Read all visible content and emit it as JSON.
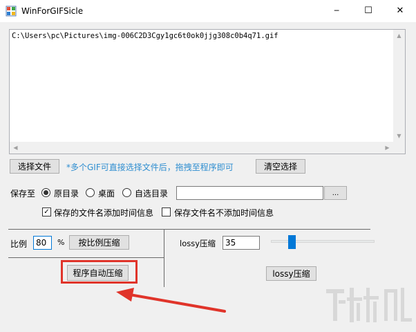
{
  "window": {
    "title": "WinForGIFSicle",
    "minimize_glyph": "─",
    "maximize_glyph": "☐",
    "close_glyph": "✕"
  },
  "file_list": {
    "items": [
      "C:\\Users\\pc\\Pictures\\img-006C2D3Cgy1gc6t0ok0jjg308c0b4q71.gif"
    ],
    "scroll_up": "▲",
    "scroll_down": "▼",
    "scroll_left": "◀",
    "scroll_right": "▶"
  },
  "file_actions": {
    "select_label": "选择文件",
    "hint": "*多个GIF可直接选择文件后，拖拽至程序即可",
    "clear_label": "清空选择"
  },
  "save": {
    "label": "保存至",
    "options": [
      "原目录",
      "桌面",
      "自选目录"
    ],
    "selected": "原目录",
    "path_value": "",
    "browse_label": "...",
    "add_time_label": "保存的文件名添加时间信息",
    "add_time_checked": true,
    "no_time_label": "保存文件名不添加时间信息",
    "no_time_checked": false,
    "check_mark": "✓"
  },
  "ratio": {
    "label": "比例",
    "value": "80",
    "unit": "%",
    "button_label": "按比例压缩"
  },
  "auto": {
    "button_label": "程序自动压缩"
  },
  "lossy": {
    "label": "lossy压缩",
    "value": "35",
    "slider_fraction": 0.18,
    "button_label": "lossy压缩"
  },
  "colors": {
    "hint": "#2f8ed0",
    "annotation": "#e0342a"
  }
}
